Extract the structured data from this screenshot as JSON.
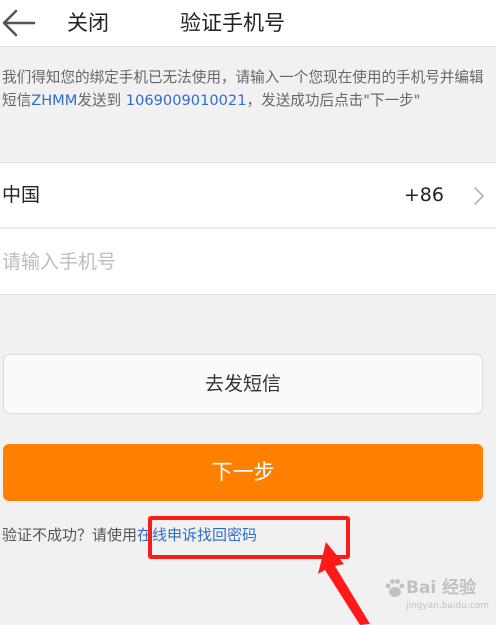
{
  "header": {
    "back_icon": "arrow-left-icon",
    "close_label": "关闭",
    "title": "验证手机号"
  },
  "notice": {
    "part1": "我们得知您的绑定手机已无法使用，请输入一个您现在使用的手机号并编辑短信",
    "sms_keyword": "ZHMM",
    "part2": "发送到",
    "sms_number": "1069009010021",
    "part3": "，发送成功后点击\"下一步\""
  },
  "country": {
    "name": "中国",
    "code": "+86",
    "icon": "chevron-right-icon"
  },
  "phone": {
    "placeholder": "请输入手机号",
    "value": ""
  },
  "buttons": {
    "send_sms_label": "去发短信",
    "next_label": "下一步"
  },
  "help": {
    "prefix": "验证不成功？请使用",
    "link_label": "在线申诉找回密码"
  },
  "watermark": {
    "text": "Bai 经验",
    "sub": "jingyan.baidu.com",
    "icon": "paw-icon"
  },
  "colors": {
    "primary": "#ff8000",
    "link": "#2f6ec8",
    "annotation": "#ff1a1a",
    "background": "#f1f1f1"
  }
}
